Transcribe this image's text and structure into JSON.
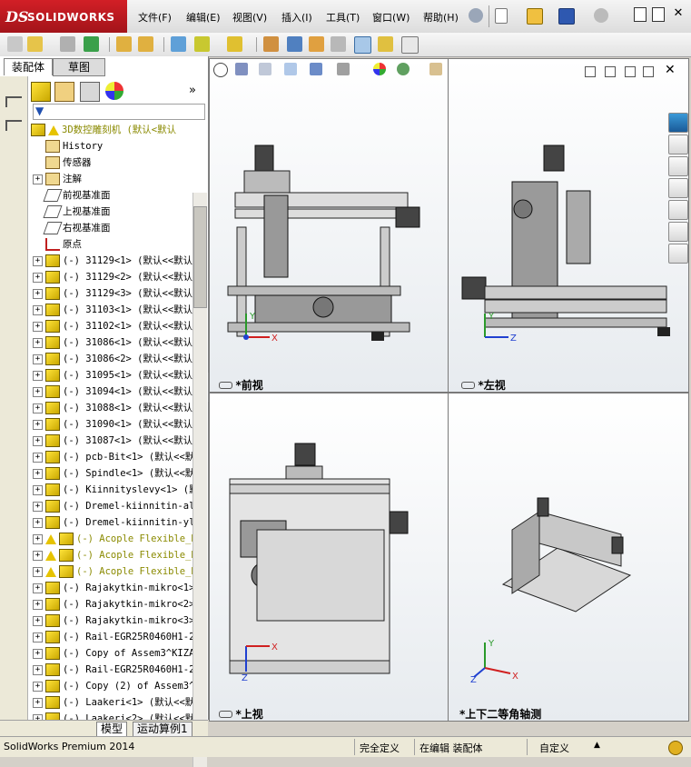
{
  "app": {
    "title_logo": "SOLIDWORKS",
    "menu": [
      "文件(F)",
      "编辑(E)",
      "视图(V)",
      "插入(I)",
      "工具(T)",
      "窗口(W)",
      "帮助(H)"
    ]
  },
  "left_panel": {
    "tabs": [
      "装配体",
      "草图"
    ],
    "tree_root": "3D数控雕刻机  (默认<默认",
    "tree_items": [
      {
        "label": "History",
        "icon": "history-icon",
        "type": "folder"
      },
      {
        "label": "传感器",
        "icon": "sensor-icon",
        "type": "folder"
      },
      {
        "label": "注解",
        "icon": "annotation-icon",
        "type": "folder",
        "expand": true
      },
      {
        "label": "前视基准面",
        "icon": "plane-icon",
        "type": "plane"
      },
      {
        "label": "上视基准面",
        "icon": "plane-icon",
        "type": "plane"
      },
      {
        "label": "右视基准面",
        "icon": "plane-icon",
        "type": "plane"
      },
      {
        "label": "原点",
        "icon": "origin-icon",
        "type": "origin"
      },
      {
        "label": "(-) 31129<1> (默认<<默认",
        "type": "part"
      },
      {
        "label": "(-) 31129<2> (默认<<默认",
        "type": "part"
      },
      {
        "label": "(-) 31129<3> (默认<<默认",
        "type": "part"
      },
      {
        "label": "(-) 31103<1> (默认<<默认",
        "type": "part"
      },
      {
        "label": "(-) 31102<1> (默认<<默认",
        "type": "part"
      },
      {
        "label": "(-) 31086<1> (默认<<默认",
        "type": "part"
      },
      {
        "label": "(-) 31086<2> (默认<<默认",
        "type": "part"
      },
      {
        "label": "(-) 31095<1> (默认<<默认",
        "type": "part"
      },
      {
        "label": "(-) 31094<1> (默认<<默认",
        "type": "part"
      },
      {
        "label": "(-) 31088<1> (默认<<默认",
        "type": "part"
      },
      {
        "label": "(-) 31090<1> (默认<<默认",
        "type": "part"
      },
      {
        "label": "(-) 31087<1> (默认<<默认",
        "type": "part"
      },
      {
        "label": "(-) pcb-Bit<1> (默认<<默",
        "type": "part"
      },
      {
        "label": "(-) Spindle<1> (默认<<默",
        "type": "part"
      },
      {
        "label": "(-) Kiinnityslevy<1> (默",
        "type": "part"
      },
      {
        "label": "(-) Dremel-kiinnitin-ala",
        "type": "part"
      },
      {
        "label": "(-) Dremel-kiinnitin-yl",
        "type": "part"
      },
      {
        "label": "(-) Acople Flexible_B",
        "type": "warn"
      },
      {
        "label": "(-) Acople Flexible_B",
        "type": "warn"
      },
      {
        "label": "(-) Acople Flexible_B",
        "type": "warn"
      },
      {
        "label": "(-) Rajakytkin-mikro<1>",
        "type": "part"
      },
      {
        "label": "(-) Rajakytkin-mikro<2>",
        "type": "part"
      },
      {
        "label": "(-) Rajakytkin-mikro<3>",
        "type": "part"
      },
      {
        "label": "(-) Rail-EGR25R0460H1-20",
        "type": "part"
      },
      {
        "label": "(-) Copy of Assem3^KIZA",
        "type": "part"
      },
      {
        "label": "(-) Rail-EGR25R0460H1-20",
        "type": "part"
      },
      {
        "label": "(-) Copy (2) of Assem3^I",
        "type": "part"
      },
      {
        "label": "(-) Laakeri<1> (默认<<默",
        "type": "part"
      },
      {
        "label": "(-) Laakeri<2> (默认<<默",
        "type": "part"
      }
    ],
    "bottom_tabs": [
      "模型",
      "运动算例1"
    ]
  },
  "viewports": [
    {
      "label": "*前视"
    },
    {
      "label": "*左视"
    },
    {
      "label": "*上视"
    },
    {
      "label": "*上下二等角轴测"
    }
  ],
  "axes": {
    "x": "X",
    "y": "Y",
    "z": "Z"
  },
  "status": {
    "product": "SolidWorks Premium 2014",
    "defined": "完全定义",
    "editing": "在编辑 装配体",
    "custom": "自定义"
  },
  "colors": {
    "brand": "#c0191f",
    "selection_blue": "#3a6ea5"
  }
}
